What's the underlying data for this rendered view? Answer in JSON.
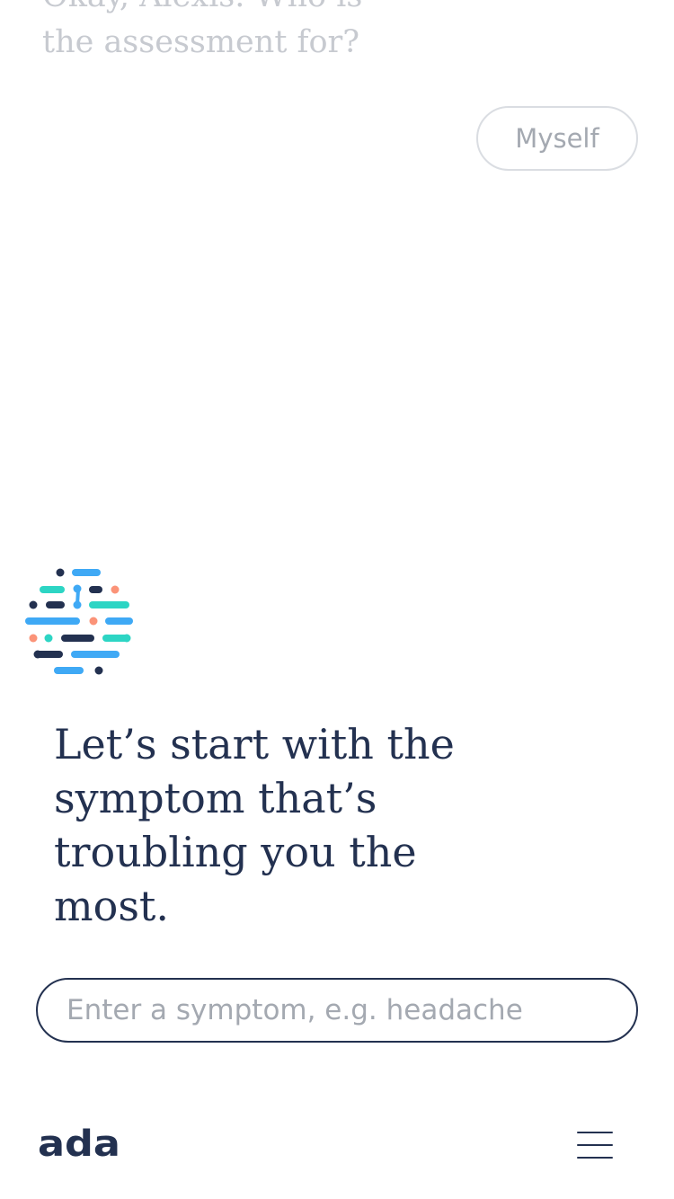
{
  "conversation": {
    "previous_question": "Okay, Alexis. Who is the assessment for?",
    "answer": "Myself",
    "current_question": "Let’s start with the symptom that’s troubling you the most."
  },
  "symptom_input": {
    "placeholder": "Enter a symptom, e.g. headache",
    "value": ""
  },
  "footer": {
    "brand": "ada",
    "menu_icon": "hamburger-menu-icon"
  },
  "colors": {
    "navy": "#233150",
    "blue": "#3fa9f5",
    "teal": "#2dd5c4",
    "coral": "#fb9378",
    "muted_text": "#c7cad0",
    "chip_border": "#dadde2"
  }
}
